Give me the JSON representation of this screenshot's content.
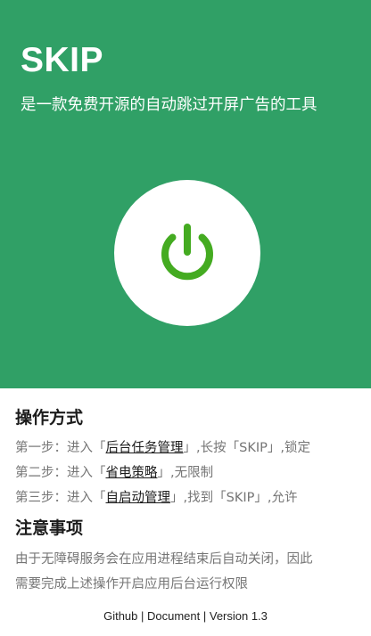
{
  "header": {
    "title": "SKIP",
    "subtitle": "是一款免费开源的自动跳过开屏广告的工具",
    "background_color": "#30a066",
    "power_icon": "power-icon",
    "power_icon_color": "#44ab21"
  },
  "usage": {
    "title": "操作方式",
    "steps": [
      {
        "prefix": "第一步：进入「",
        "link": "后台任务管理",
        "suffix": "」,长按「SKIP」,锁定"
      },
      {
        "prefix": "第二步：进入「",
        "link": "省电策略",
        "suffix": "」,无限制"
      },
      {
        "prefix": "第三步：进入「",
        "link": "自启动管理",
        "suffix": "」,找到「SKIP」,允许"
      }
    ]
  },
  "notes": {
    "title": "注意事项",
    "line1": "由于无障碍服务会在应用进程结束后自动关闭，因此",
    "line2": "需要完成上述操作开启应用后台运行权限"
  },
  "footer": {
    "github": "Github",
    "separator": " | ",
    "document": "Document",
    "version": "Version 1.3"
  }
}
